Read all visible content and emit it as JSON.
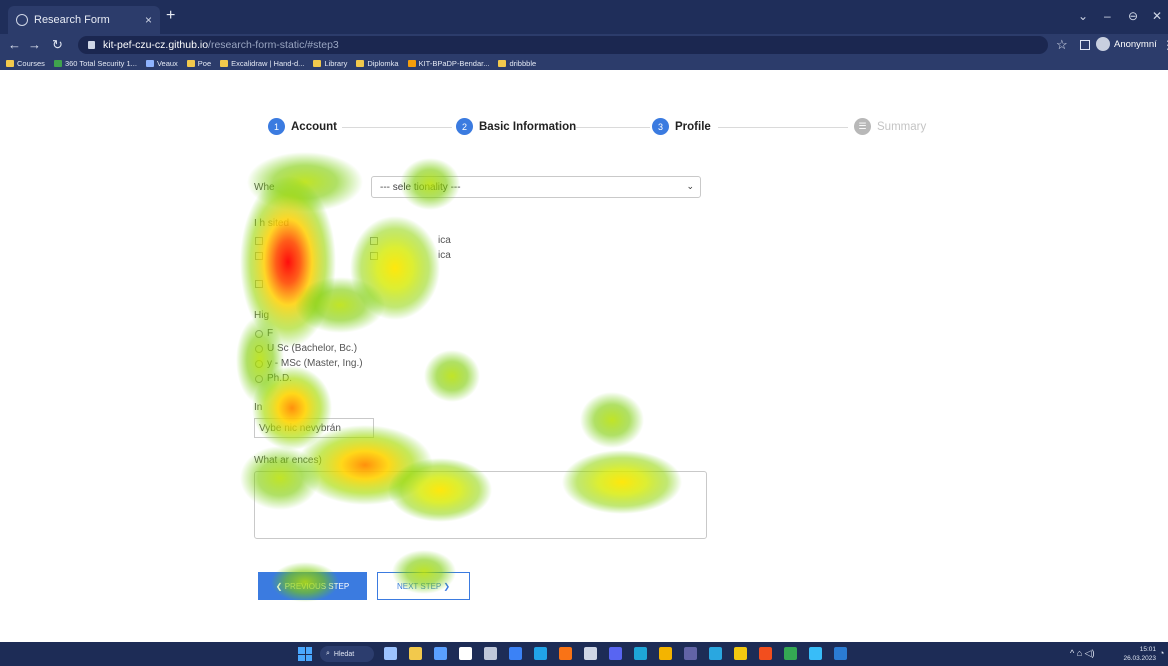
{
  "browser": {
    "tab_title": "Research Form",
    "tab_close": "×",
    "new_tab": "+",
    "window_controls": [
      "⌄",
      "–",
      "⊖",
      "✕"
    ],
    "url_host": "kit-pef-czu-cz.github.io",
    "url_path": "/research-form-static/#step3",
    "star": "☆",
    "profile_name": "Anonymní",
    "menu": "⋮",
    "bookmarks": [
      {
        "label": "Courses",
        "color": "#f2c94c"
      },
      {
        "label": "360 Total Security 1...",
        "color": "#3fa34d"
      },
      {
        "label": "Veaux",
        "color": "#8fb3ff"
      },
      {
        "label": "Poe",
        "color": "#f2c94c"
      },
      {
        "label": "Excalidraw | Hand-d...",
        "color": "#f2c94c"
      },
      {
        "label": "Library",
        "color": "#f2c94c"
      },
      {
        "label": "Diplomka",
        "color": "#f2c94c"
      },
      {
        "label": "KIT-BPaDP-Bendar...",
        "color": "#f59e0b"
      },
      {
        "label": "dribbble",
        "color": "#f2c94c"
      }
    ]
  },
  "stepper": {
    "steps": [
      {
        "num": "1",
        "label": "Account",
        "state": "done"
      },
      {
        "num": "2",
        "label": "Basic Information",
        "state": "done"
      },
      {
        "num": "3",
        "label": "Profile",
        "state": "active"
      },
      {
        "num": "",
        "label": "Summary",
        "state": "disabled"
      }
    ]
  },
  "form": {
    "nationality_label": "Whe",
    "nationality_placeholder": "--- sele         tionality ---",
    "visited_label": "I h                  sited",
    "visited_opt_1": "ica",
    "visited_opt_2": "ica",
    "education_label": "Hig",
    "education_opts": [
      "F",
      "U             Sc (Bachelor, Bc.)",
      "                  y - MSc (Master, Ing.)",
      "                   Ph.D."
    ],
    "interests_label": "In",
    "interests_value": "Vybe                  nic nevybrán",
    "essay_label": "What ar                                        ences)"
  },
  "buttons": {
    "prev": "❮ PREVIOUS STEP",
    "next": "NEXT STEP ❯"
  },
  "taskbar": {
    "search_label": "Hledat",
    "tray_icons": "^ ⌂ ◁)",
    "time": "15:01",
    "date": "26.03.2023",
    "icons": [
      {
        "name": "task-view",
        "color": "#9cc3ff"
      },
      {
        "name": "files",
        "color": "#f2c94c"
      },
      {
        "name": "calendar",
        "color": "#5aa0ff"
      },
      {
        "name": "notes",
        "color": "#ffffff"
      },
      {
        "name": "settings",
        "color": "#c0c8da"
      },
      {
        "name": "mail",
        "color": "#3b82f6"
      },
      {
        "name": "edge",
        "color": "#21a3e8"
      },
      {
        "name": "photos",
        "color": "#f97316"
      },
      {
        "name": "steam",
        "color": "#cfd6e6"
      },
      {
        "name": "discord",
        "color": "#5865f2"
      },
      {
        "name": "edge-2",
        "color": "#1ea5d8"
      },
      {
        "name": "chrome",
        "color": "#f4b400"
      },
      {
        "name": "teams",
        "color": "#6264a7"
      },
      {
        "name": "telegram",
        "color": "#2aa7e0"
      },
      {
        "name": "powerbi",
        "color": "#f2c811"
      },
      {
        "name": "figma",
        "color": "#f24e1e"
      },
      {
        "name": "chrome-2",
        "color": "#34a853"
      },
      {
        "name": "app",
        "color": "#38bdf8"
      },
      {
        "name": "word",
        "color": "#2b7cd3"
      }
    ]
  }
}
